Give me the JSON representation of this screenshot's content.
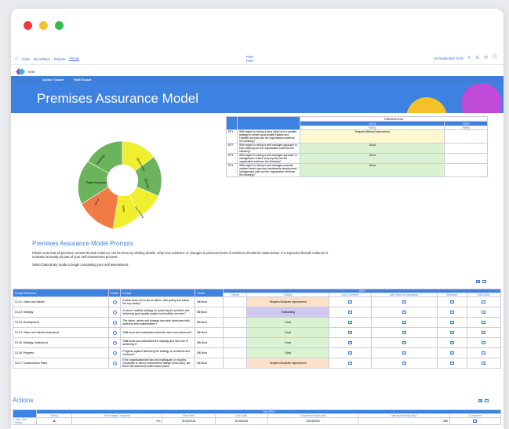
{
  "window": {
    "dots": [
      "#ef3b3b",
      "#f5c12a",
      "#32c04a"
    ]
  },
  "topnav": {
    "links": [
      "Crisis",
      "My InPlace",
      "Reports",
      "Forces"
    ],
    "center_lines": [
      "PAM",
      "PAM"
    ],
    "date": "29 September 2018"
  },
  "brand": {
    "label": "NHS"
  },
  "bluebar": {
    "items": [
      "Action Tracker",
      "PAM Export"
    ]
  },
  "banner": {
    "title": "Premises Assurance Model"
  },
  "effectiveness": {
    "title": "Effectiveness",
    "years": [
      "2019",
      "2020"
    ],
    "rating_label": "Rating",
    "rows": [
      {
        "code": "EF1",
        "text": "With regard to having a clear vision and a credible strategy to deliver good quality Estates and Facilities services can the organisation evidence the following?",
        "rating": "Requires Minimal Improvement",
        "color": "#fdf8cf"
      },
      {
        "code": "EF2",
        "text": "With regard to having a well managed approach to best planning can the organisation evidence the following?",
        "rating": "Good",
        "color": "#d9f2cf"
      },
      {
        "code": "EF3",
        "text": "With regard to having a well managed approach to management of land and property can the organisation evidence the following?",
        "rating": "Good",
        "color": "#d9f2cf"
      },
      {
        "code": "EF4",
        "text": "With regard to having a well managed accurate updated board approved sustainable development management plan can the organisation evidence the following?",
        "rating": "Good",
        "color": "#d9f2cf"
      }
    ]
  },
  "wheel": {
    "segments": [
      {
        "label": "Effectiveness",
        "color": "#f0ef2e"
      },
      {
        "label": "Efficiency",
        "color": "#6cb35d"
      },
      {
        "label": "Safety",
        "color": "#f0ef2e"
      },
      {
        "label": "Org & Comp",
        "color": "#f0ef2e"
      },
      {
        "label": "Use of",
        "color": "#f07b45"
      },
      {
        "label": "Patient Experience",
        "color": "#6cb35d"
      },
      {
        "label": "Leadership",
        "color": "#6cb35d"
      }
    ]
  },
  "prompts_section": {
    "title": "Premises Assurance Model Prompts",
    "para1": "Please note that all previous comments and evidence can be seen by clicking details. Only new evidence or changes to previous items of evidence should be made below. It is expected that all evidence is reviewed annually as part of your self assessment process.",
    "para2": "Select Data Entry mode to begin completing your self assessment."
  },
  "prompts_table": {
    "headers": [
      "Prompt Reference",
      "Details",
      "Prompt",
      "Owner"
    ],
    "year": "2019",
    "subheaders": [
      "Rating",
      "Rating",
      "Add Comment",
      "Add Steps to Assurance",
      "Evidence",
      "Add Action"
    ],
    "rows": [
      {
        "ref": "S1.01: Vision and Values",
        "prompt": "A clear vision and a set of values, with quality and safety the top priority?",
        "owner": "Bill Boot",
        "rating": "Requires Moderate Improvement",
        "color": "#fbe1c8"
      },
      {
        "ref": "S1.02: Strategy",
        "prompt": "A robust, realistic strategy for achieving the priorities and delivering good quality estates and facilities services?",
        "owner": "Bill Boot",
        "rating": "Outstanding",
        "color": "#d0c8f0"
      },
      {
        "ref": "S1.03: Development",
        "prompt": "The vision, values and strategy has been developed with staff and other stakeholders?",
        "owner": "Bill Boot",
        "rating": "Good",
        "color": "#d9f2cf"
      },
      {
        "ref": "S1.04: Vision and Values Understood",
        "prompt": "Staff know and understand what the vision and values are?",
        "owner": "Bill Boot",
        "rating": "Good",
        "color": "#d9f2cf"
      },
      {
        "ref": "S1.05: Strategy Understood",
        "prompt": "Staff know and understand the strategy and their role in achieving it?",
        "owner": "Bill Boot",
        "rating": "Good",
        "color": "#d9f2cf"
      },
      {
        "ref": "S1.06: Progress",
        "prompt": "Progress against delivering the strategy is monitored and reviewed?",
        "owner": "Bill Boot",
        "rating": "Good",
        "color": "#d9f2cf"
      },
      {
        "ref": "S1.07: Costed Action Plans",
        "prompt": "If the organisation/site has any inadequate or requires (moderate or minor) improvement ratings in this SAQ, are there site assessed costed action plans",
        "owner": "Bill Boot",
        "rating": "Requires Moderate Improvement",
        "color": "#fbe1c8"
      }
    ]
  },
  "actions": {
    "title": "Actions",
    "period": "Sep 2019",
    "headers": [
      "Rating",
      "Percentage Complete",
      "Start Date",
      "Due Date",
      "Completion Date (est)",
      "Late by Working Days",
      "Comments"
    ],
    "row": {
      "name": "Test - Red Action",
      "percent": "0%",
      "start": "01/02/2018",
      "due": "31/03/2018",
      "completion": "31/03/2018",
      "late": "388"
    }
  }
}
